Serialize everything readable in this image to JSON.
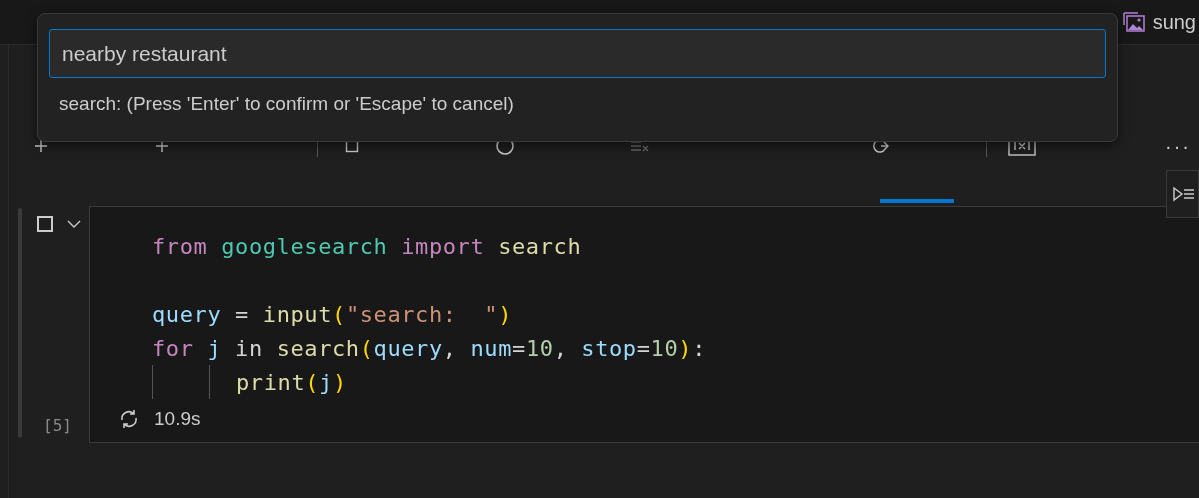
{
  "editor_tab": {
    "label": "sung"
  },
  "toolbar": [
    {
      "kind": "plus",
      "disabled": false
    },
    {
      "kind": "plus",
      "disabled": false
    },
    {
      "kind": "separator"
    },
    {
      "kind": "interrupt",
      "disabled": false
    },
    {
      "kind": "restart",
      "disabled": false
    },
    {
      "kind": "clear",
      "disabled": true
    },
    {
      "kind": "goto",
      "disabled": false
    },
    {
      "kind": "separator"
    },
    {
      "kind": "variables",
      "disabled": false
    },
    {
      "kind": "more",
      "label": "···",
      "disabled": false
    }
  ],
  "cell": {
    "execution_count": "[5]",
    "duration": "10.9s",
    "lines": [
      {
        "kind": "code",
        "indented": false,
        "tokens": [
          {
            "kind": "keyword",
            "s": "from "
          },
          {
            "kind": "module",
            "s": "googlesearch "
          },
          {
            "kind": "keyword",
            "s": "import "
          },
          {
            "kind": "function",
            "s": "search"
          }
        ]
      },
      {
        "kind": "blank"
      },
      {
        "kind": "code",
        "indented": false,
        "tokens": [
          {
            "kind": "variable",
            "s": "query"
          },
          {
            "kind": "plain",
            "s": " = "
          },
          {
            "kind": "function",
            "s": "input"
          },
          {
            "kind": "bracket",
            "s": "("
          },
          {
            "kind": "string",
            "s": "\"search:  \""
          },
          {
            "kind": "bracket",
            "s": ")"
          }
        ]
      },
      {
        "kind": "code",
        "indented": false,
        "tokens": [
          {
            "kind": "keyword",
            "s": "for "
          },
          {
            "kind": "variable",
            "s": "j"
          },
          {
            "kind": "plain",
            "s": " in "
          },
          {
            "kind": "function",
            "s": "search"
          },
          {
            "kind": "bracket",
            "s": "("
          },
          {
            "kind": "variable",
            "s": "query"
          },
          {
            "kind": "plain",
            "s": ", "
          },
          {
            "kind": "variable",
            "s": "num"
          },
          {
            "kind": "plain",
            "s": "="
          },
          {
            "kind": "number",
            "s": "10"
          },
          {
            "kind": "plain",
            "s": ", "
          },
          {
            "kind": "variable",
            "s": "stop"
          },
          {
            "kind": "plain",
            "s": "="
          },
          {
            "kind": "number",
            "s": "10"
          },
          {
            "kind": "bracket",
            "s": ")"
          },
          {
            "kind": "plain",
            "s": ":"
          }
        ]
      },
      {
        "kind": "code",
        "indented": true,
        "tokens": [
          {
            "kind": "function",
            "s": "print"
          },
          {
            "kind": "bracket",
            "s": "("
          },
          {
            "kind": "variable",
            "s": "j"
          },
          {
            "kind": "bracket",
            "s": ")"
          }
        ]
      }
    ]
  },
  "input_box": {
    "value": "nearby restaurant",
    "hint": "search: (Press 'Enter' to confirm or 'Escape' to cancel)"
  }
}
